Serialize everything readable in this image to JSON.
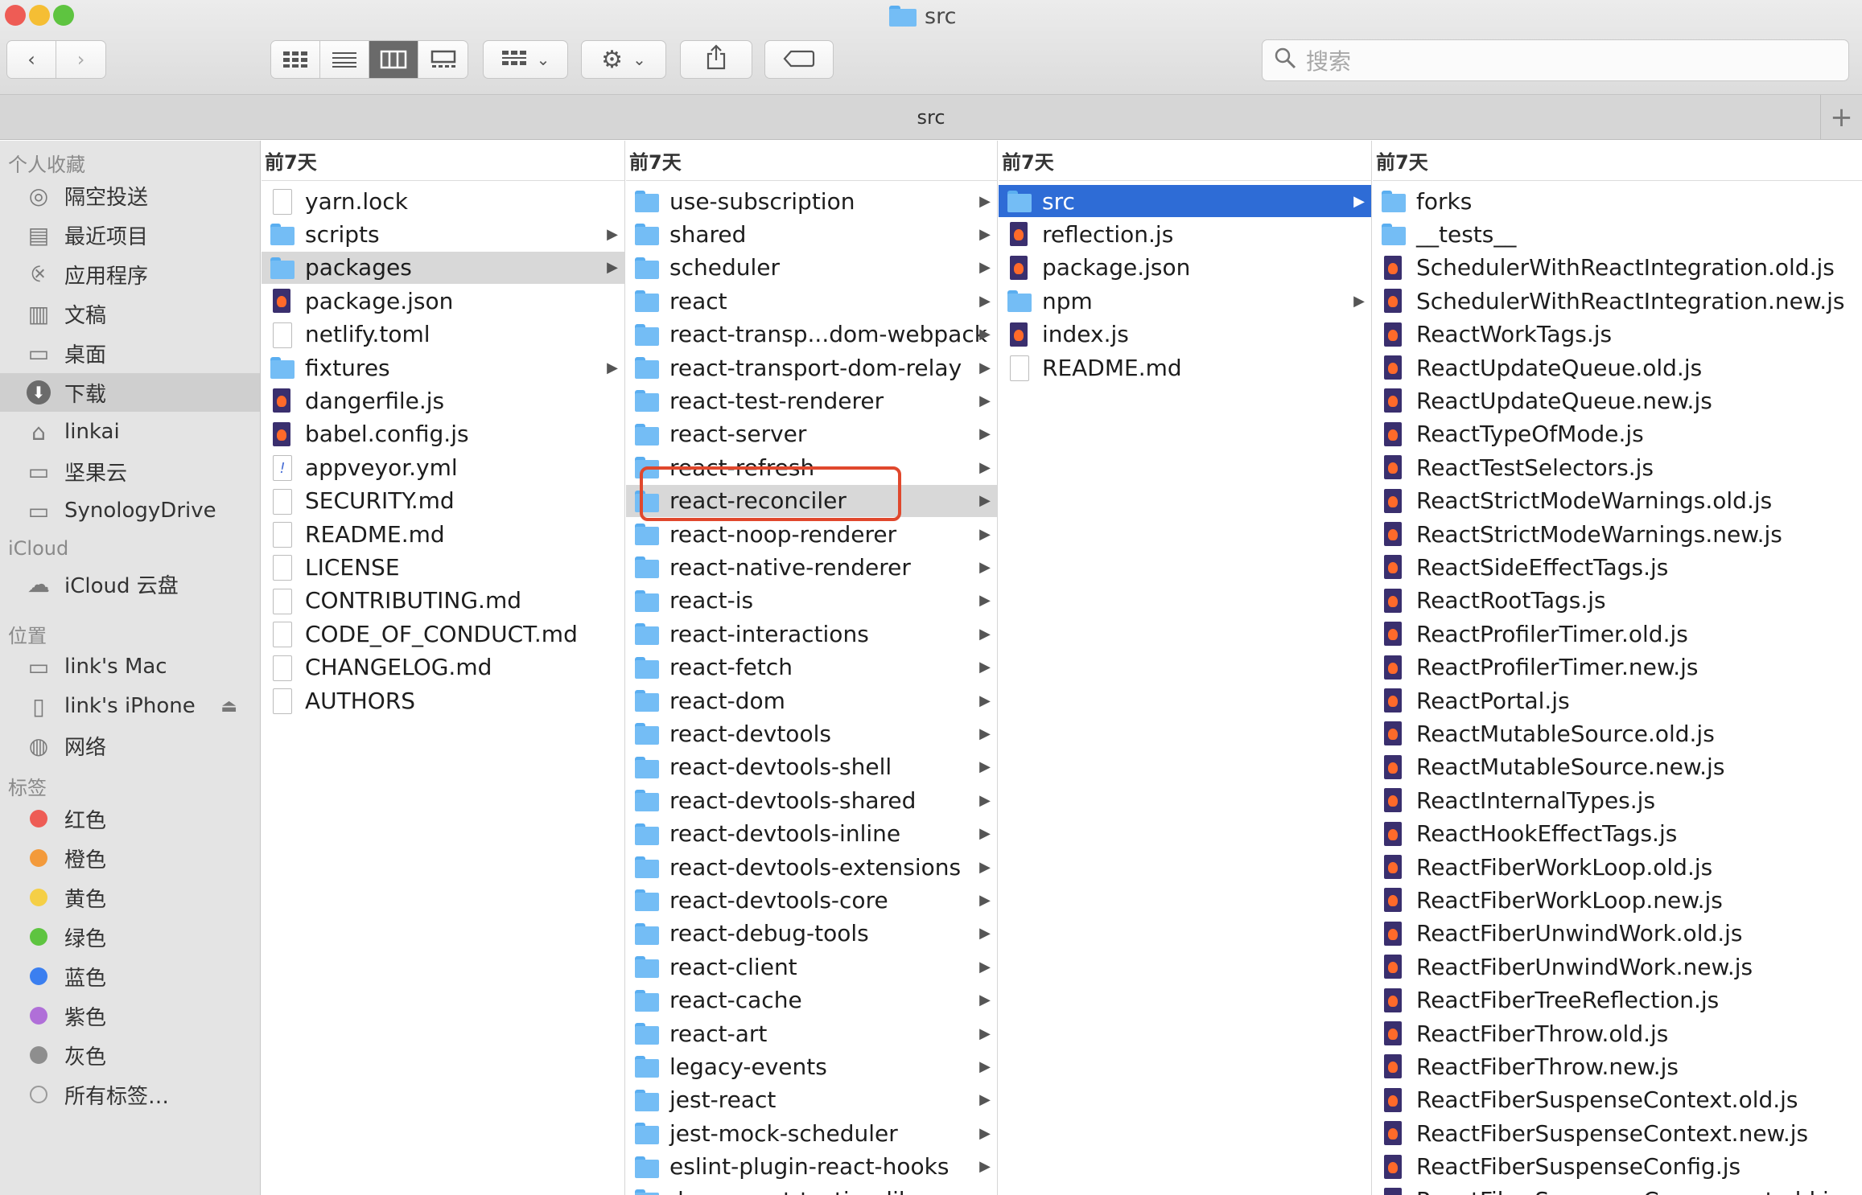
{
  "window": {
    "title": "src",
    "traffic_lights": {
      "close": "#ee5c55",
      "minimize": "#f5be34",
      "zoom": "#5ec440"
    },
    "accent_color": "#2e6cd6",
    "highlight_color": "#e0482d"
  },
  "toolbar": {
    "back_icon": "chevron-left-icon",
    "forward_icon": "chevron-right-icon",
    "view_modes": [
      "icon-view-icon",
      "list-view-icon",
      "column-view-icon",
      "gallery-view-icon"
    ],
    "active_view": "column-view-icon",
    "group_icon": "group-icon",
    "action_icon": "gear-icon",
    "share_icon": "share-icon",
    "tag_icon": "tag-icon",
    "search_placeholder": "搜索"
  },
  "pathbar": {
    "label": "src",
    "add_tab": "+"
  },
  "sidebar": {
    "favorites_header": "个人收藏",
    "favorites": [
      {
        "label": "隔空投送",
        "icon": "airdrop-icon"
      },
      {
        "label": "最近项目",
        "icon": "recents-icon"
      },
      {
        "label": "应用程序",
        "icon": "applications-icon"
      },
      {
        "label": "文稿",
        "icon": "documents-icon"
      },
      {
        "label": "桌面",
        "icon": "desktop-icon"
      },
      {
        "label": "下载",
        "icon": "downloads-icon",
        "active": true
      },
      {
        "label": "linkai",
        "icon": "home-icon"
      },
      {
        "label": "坚果云",
        "icon": "folder-icon"
      },
      {
        "label": "SynologyDrive",
        "icon": "folder-icon"
      }
    ],
    "icloud_header": "iCloud",
    "icloud": [
      {
        "label": "iCloud 云盘",
        "icon": "cloud-icon"
      }
    ],
    "locations_header": "位置",
    "locations": [
      {
        "label": "link's Mac",
        "icon": "computer-icon"
      },
      {
        "label": "link's iPhone",
        "icon": "iphone-icon",
        "eject": "⏏"
      },
      {
        "label": "网络",
        "icon": "network-icon"
      }
    ],
    "tags_header": "标签",
    "tags": [
      {
        "label": "红色",
        "color": "#ee5c55"
      },
      {
        "label": "橙色",
        "color": "#f39a3b"
      },
      {
        "label": "黄色",
        "color": "#f5cf46"
      },
      {
        "label": "绿色",
        "color": "#5ec440"
      },
      {
        "label": "蓝色",
        "color": "#3b7ff0"
      },
      {
        "label": "紫色",
        "color": "#b06fd8"
      },
      {
        "label": "灰色",
        "color": "#8e8e8e"
      },
      {
        "label": "所有标签…",
        "color": "#e4e4e4"
      }
    ]
  },
  "columns": [
    {
      "header": "前7天",
      "items": [
        {
          "name": "yarn.lock",
          "type": "doc"
        },
        {
          "name": "scripts",
          "type": "folder"
        },
        {
          "name": "packages",
          "type": "folder",
          "selected": "gray"
        },
        {
          "name": "package.json",
          "type": "js"
        },
        {
          "name": "netlify.toml",
          "type": "doc"
        },
        {
          "name": "fixtures",
          "type": "folder"
        },
        {
          "name": "dangerfile.js",
          "type": "js"
        },
        {
          "name": "babel.config.js",
          "type": "js"
        },
        {
          "name": "appveyor.yml",
          "type": "yml"
        },
        {
          "name": "SECURITY.md",
          "type": "doc"
        },
        {
          "name": "README.md",
          "type": "doc"
        },
        {
          "name": "LICENSE",
          "type": "doc"
        },
        {
          "name": "CONTRIBUTING.md",
          "type": "doc"
        },
        {
          "name": "CODE_OF_CONDUCT.md",
          "type": "doc"
        },
        {
          "name": "CHANGELOG.md",
          "type": "doc"
        },
        {
          "name": "AUTHORS",
          "type": "doc"
        }
      ]
    },
    {
      "header": "前7天",
      "items": [
        {
          "name": "use-subscription",
          "type": "folder"
        },
        {
          "name": "shared",
          "type": "folder"
        },
        {
          "name": "scheduler",
          "type": "folder"
        },
        {
          "name": "react",
          "type": "folder"
        },
        {
          "name": "react-transp...dom-webpack",
          "type": "folder"
        },
        {
          "name": "react-transport-dom-relay",
          "type": "folder"
        },
        {
          "name": "react-test-renderer",
          "type": "folder"
        },
        {
          "name": "react-server",
          "type": "folder"
        },
        {
          "name": "react-refresh",
          "type": "folder"
        },
        {
          "name": "react-reconciler",
          "type": "folder",
          "selected": "gray",
          "highlighted": true
        },
        {
          "name": "react-noop-renderer",
          "type": "folder"
        },
        {
          "name": "react-native-renderer",
          "type": "folder"
        },
        {
          "name": "react-is",
          "type": "folder"
        },
        {
          "name": "react-interactions",
          "type": "folder"
        },
        {
          "name": "react-fetch",
          "type": "folder"
        },
        {
          "name": "react-dom",
          "type": "folder"
        },
        {
          "name": "react-devtools",
          "type": "folder"
        },
        {
          "name": "react-devtools-shell",
          "type": "folder"
        },
        {
          "name": "react-devtools-shared",
          "type": "folder"
        },
        {
          "name": "react-devtools-inline",
          "type": "folder"
        },
        {
          "name": "react-devtools-extensions",
          "type": "folder"
        },
        {
          "name": "react-devtools-core",
          "type": "folder"
        },
        {
          "name": "react-debug-tools",
          "type": "folder"
        },
        {
          "name": "react-client",
          "type": "folder"
        },
        {
          "name": "react-cache",
          "type": "folder"
        },
        {
          "name": "react-art",
          "type": "folder"
        },
        {
          "name": "legacy-events",
          "type": "folder"
        },
        {
          "name": "jest-react",
          "type": "folder"
        },
        {
          "name": "jest-mock-scheduler",
          "type": "folder"
        },
        {
          "name": "eslint-plugin-react-hooks",
          "type": "folder"
        },
        {
          "name": "dom-event-testing-library",
          "type": "folder"
        }
      ]
    },
    {
      "header": "前7天",
      "items": [
        {
          "name": "src",
          "type": "folder",
          "selected": "blue"
        },
        {
          "name": "reflection.js",
          "type": "js"
        },
        {
          "name": "package.json",
          "type": "js"
        },
        {
          "name": "npm",
          "type": "folder"
        },
        {
          "name": "index.js",
          "type": "js"
        },
        {
          "name": "README.md",
          "type": "doc"
        }
      ]
    },
    {
      "header": "前7天",
      "items": [
        {
          "name": "forks",
          "type": "folder"
        },
        {
          "name": "__tests__",
          "type": "folder"
        },
        {
          "name": "SchedulerWithReactIntegration.old.js",
          "type": "js"
        },
        {
          "name": "SchedulerWithReactIntegration.new.js",
          "type": "js"
        },
        {
          "name": "ReactWorkTags.js",
          "type": "js"
        },
        {
          "name": "ReactUpdateQueue.old.js",
          "type": "js"
        },
        {
          "name": "ReactUpdateQueue.new.js",
          "type": "js"
        },
        {
          "name": "ReactTypeOfMode.js",
          "type": "js"
        },
        {
          "name": "ReactTestSelectors.js",
          "type": "js"
        },
        {
          "name": "ReactStrictModeWarnings.old.js",
          "type": "js"
        },
        {
          "name": "ReactStrictModeWarnings.new.js",
          "type": "js"
        },
        {
          "name": "ReactSideEffectTags.js",
          "type": "js"
        },
        {
          "name": "ReactRootTags.js",
          "type": "js"
        },
        {
          "name": "ReactProfilerTimer.old.js",
          "type": "js"
        },
        {
          "name": "ReactProfilerTimer.new.js",
          "type": "js"
        },
        {
          "name": "ReactPortal.js",
          "type": "js"
        },
        {
          "name": "ReactMutableSource.old.js",
          "type": "js"
        },
        {
          "name": "ReactMutableSource.new.js",
          "type": "js"
        },
        {
          "name": "ReactInternalTypes.js",
          "type": "js"
        },
        {
          "name": "ReactHookEffectTags.js",
          "type": "js"
        },
        {
          "name": "ReactFiberWorkLoop.old.js",
          "type": "js"
        },
        {
          "name": "ReactFiberWorkLoop.new.js",
          "type": "js"
        },
        {
          "name": "ReactFiberUnwindWork.old.js",
          "type": "js"
        },
        {
          "name": "ReactFiberUnwindWork.new.js",
          "type": "js"
        },
        {
          "name": "ReactFiberTreeReflection.js",
          "type": "js"
        },
        {
          "name": "ReactFiberThrow.old.js",
          "type": "js"
        },
        {
          "name": "ReactFiberThrow.new.js",
          "type": "js"
        },
        {
          "name": "ReactFiberSuspenseContext.old.js",
          "type": "js"
        },
        {
          "name": "ReactFiberSuspenseContext.new.js",
          "type": "js"
        },
        {
          "name": "ReactFiberSuspenseConfig.js",
          "type": "js"
        },
        {
          "name": "ReactFiberSuspenseComponent.old.js",
          "type": "js"
        }
      ]
    }
  ]
}
